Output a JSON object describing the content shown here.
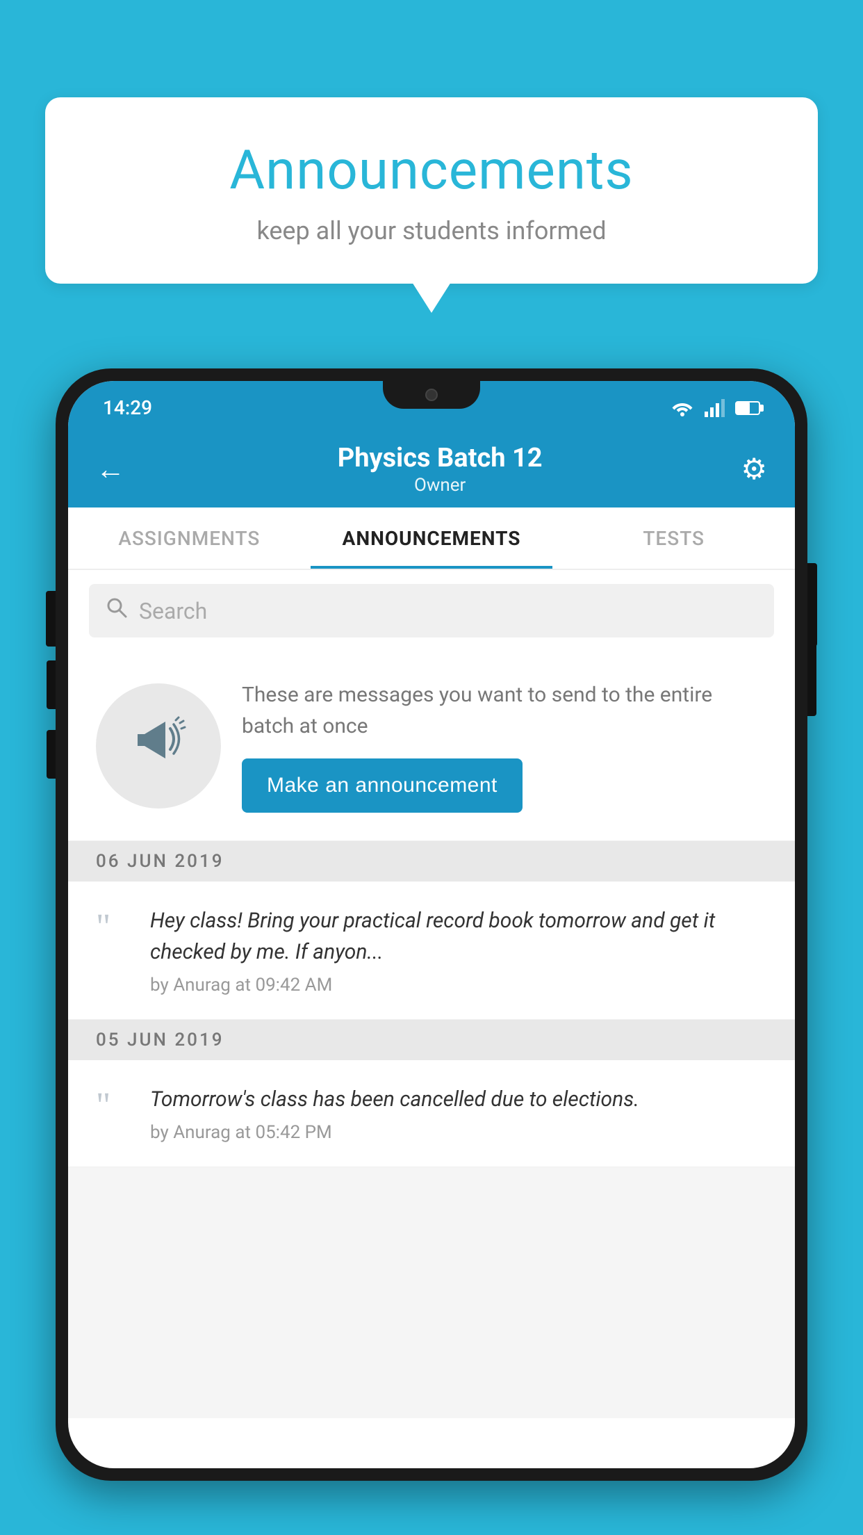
{
  "background_color": "#29b6d8",
  "speech_bubble": {
    "title": "Announcements",
    "subtitle": "keep all your students informed"
  },
  "phone": {
    "status_bar": {
      "time": "14:29"
    },
    "header": {
      "title": "Physics Batch 12",
      "subtitle": "Owner",
      "back_label": "←",
      "settings_label": "⚙"
    },
    "tabs": [
      {
        "label": "ASSIGNMENTS",
        "active": false
      },
      {
        "label": "ANNOUNCEMENTS",
        "active": true
      },
      {
        "label": "TESTS",
        "active": false
      }
    ],
    "search": {
      "placeholder": "Search"
    },
    "promo": {
      "description": "These are messages you want to send to the entire batch at once",
      "button_label": "Make an announcement"
    },
    "announcements": [
      {
        "date": "06  JUN  2019",
        "text": "Hey class! Bring your practical record book tomorrow and get it checked by me. If anyon...",
        "meta": "by Anurag at 09:42 AM"
      },
      {
        "date": "05  JUN  2019",
        "text": "Tomorrow's class has been cancelled due to elections.",
        "meta": "by Anurag at 05:42 PM"
      }
    ]
  }
}
